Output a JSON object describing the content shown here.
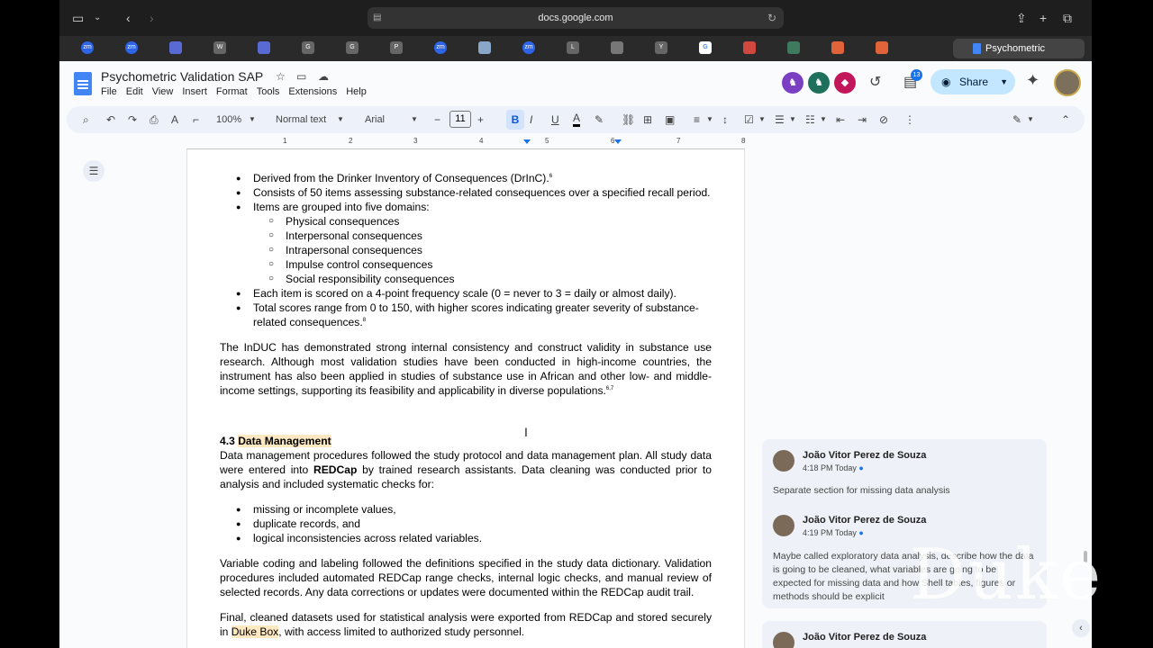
{
  "browser": {
    "url": "docs.google.com",
    "active_tab_title": "Psychometric Validat...",
    "tabs": [
      "zm",
      "zm",
      "",
      "W",
      "",
      "G",
      "G",
      "P",
      "zm",
      "",
      "zm",
      "L",
      "",
      "Y",
      "G",
      "",
      "",
      "",
      "",
      ""
    ]
  },
  "doc": {
    "title": "Psychometric Validation SAP",
    "menus": [
      "File",
      "Edit",
      "View",
      "Insert",
      "Format",
      "Tools",
      "Extensions",
      "Help"
    ],
    "share_label": "Share",
    "notification_count": "13"
  },
  "toolbar": {
    "zoom": "100%",
    "style": "Normal text",
    "font": "Arial",
    "font_size": "11"
  },
  "ruler": {
    "numbers": [
      "1",
      "2",
      "3",
      "4",
      "5",
      "6",
      "7",
      "8"
    ]
  },
  "content": {
    "bullets1": [
      {
        "text": "Derived from the Drinker Inventory of Consequences (DrInC).",
        "sup": "6"
      },
      {
        "text": "Consists of 50 items assessing substance-related consequences over a specified recall period.",
        "sup": ""
      },
      {
        "text": "Items are grouped into five domains:",
        "sup": ""
      }
    ],
    "domains": [
      "Physical consequences",
      "Interpersonal consequences",
      "Intrapersonal consequences",
      "Impulse control consequences",
      "Social responsibility consequences"
    ],
    "bullets2": [
      {
        "text": "Each item is scored on a 4-point frequency scale (0 = never to 3 = daily or almost daily).",
        "sup": ""
      },
      {
        "text": "Total scores range from 0 to 150, with higher scores indicating greater severity of substance-related consequences.",
        "sup": "8"
      }
    ],
    "para1": "The InDUC has demonstrated strong internal consistency and construct validity in substance use research. Although most validation studies have been conducted in high-income countries, the instrument has also been applied in studies of substance use in African and other low- and middle-income settings, supporting its feasibility and applicability in diverse populations.",
    "para1_sup": "6,7",
    "section_number": "4.3 ",
    "section_title": "Data Management",
    "para2_a": "Data management procedures followed the study protocol and data management plan. All study data were entered into ",
    "para2_bold": "REDCap",
    "para2_b": " by trained research assistants. Data cleaning was conducted prior to analysis and included systematic checks for:",
    "checks": [
      "missing or incomplete values,",
      "duplicate records, and",
      "logical inconsistencies across related variables."
    ],
    "para3": "Variable coding and labeling followed the definitions specified in the study data dictionary. Validation procedures included automated REDCap range checks, internal logic checks, and manual review of selected records. Any data corrections or updates were documented within the REDCap audit trail.",
    "para4_a": "Final, cleaned datasets used for statistical analysis were exported from REDCap and stored securely in ",
    "para4_hl": "Duke Box",
    "para4_b": ", with access limited to authorized study personnel."
  },
  "comments": [
    {
      "author": "João Vitor Perez de Souza",
      "time": "4:18 PM Today",
      "text": "Separate section for missing data analysis"
    },
    {
      "author": "João Vitor Perez de Souza",
      "time": "4:19 PM Today",
      "text": "Maybe called exploratory data analysis, describe how the data is going to be cleaned, what variables are going to be expected for missing data and how Shell tables, figures or methods should be explicit"
    },
    {
      "author": "João Vitor Perez de Souza",
      "time": "",
      "text": ""
    }
  ],
  "watermark": "Duke"
}
